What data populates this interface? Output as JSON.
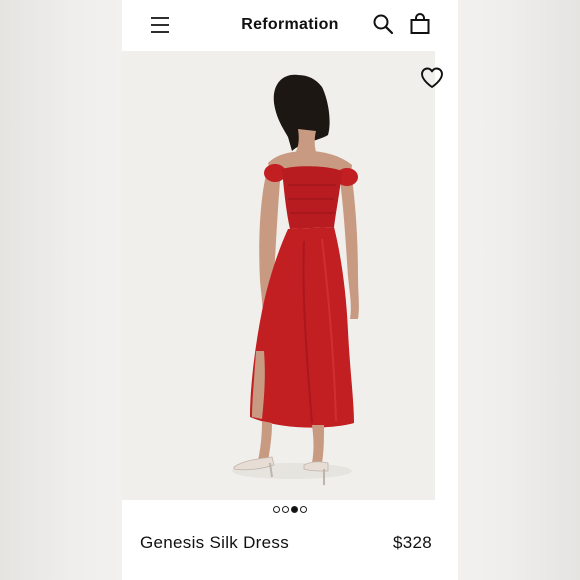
{
  "app": {
    "brand": "Reformation"
  },
  "header": {
    "menu_icon": "hamburger-menu-icon",
    "search_icon": "search-icon",
    "bag_icon": "shopping-bag-icon"
  },
  "gallery": {
    "favorite_icon": "heart-outline-icon",
    "image_count": 4,
    "active_index": 2,
    "dress_color": "#c21f23"
  },
  "product": {
    "name": "Genesis Silk Dress",
    "price": "$328"
  }
}
